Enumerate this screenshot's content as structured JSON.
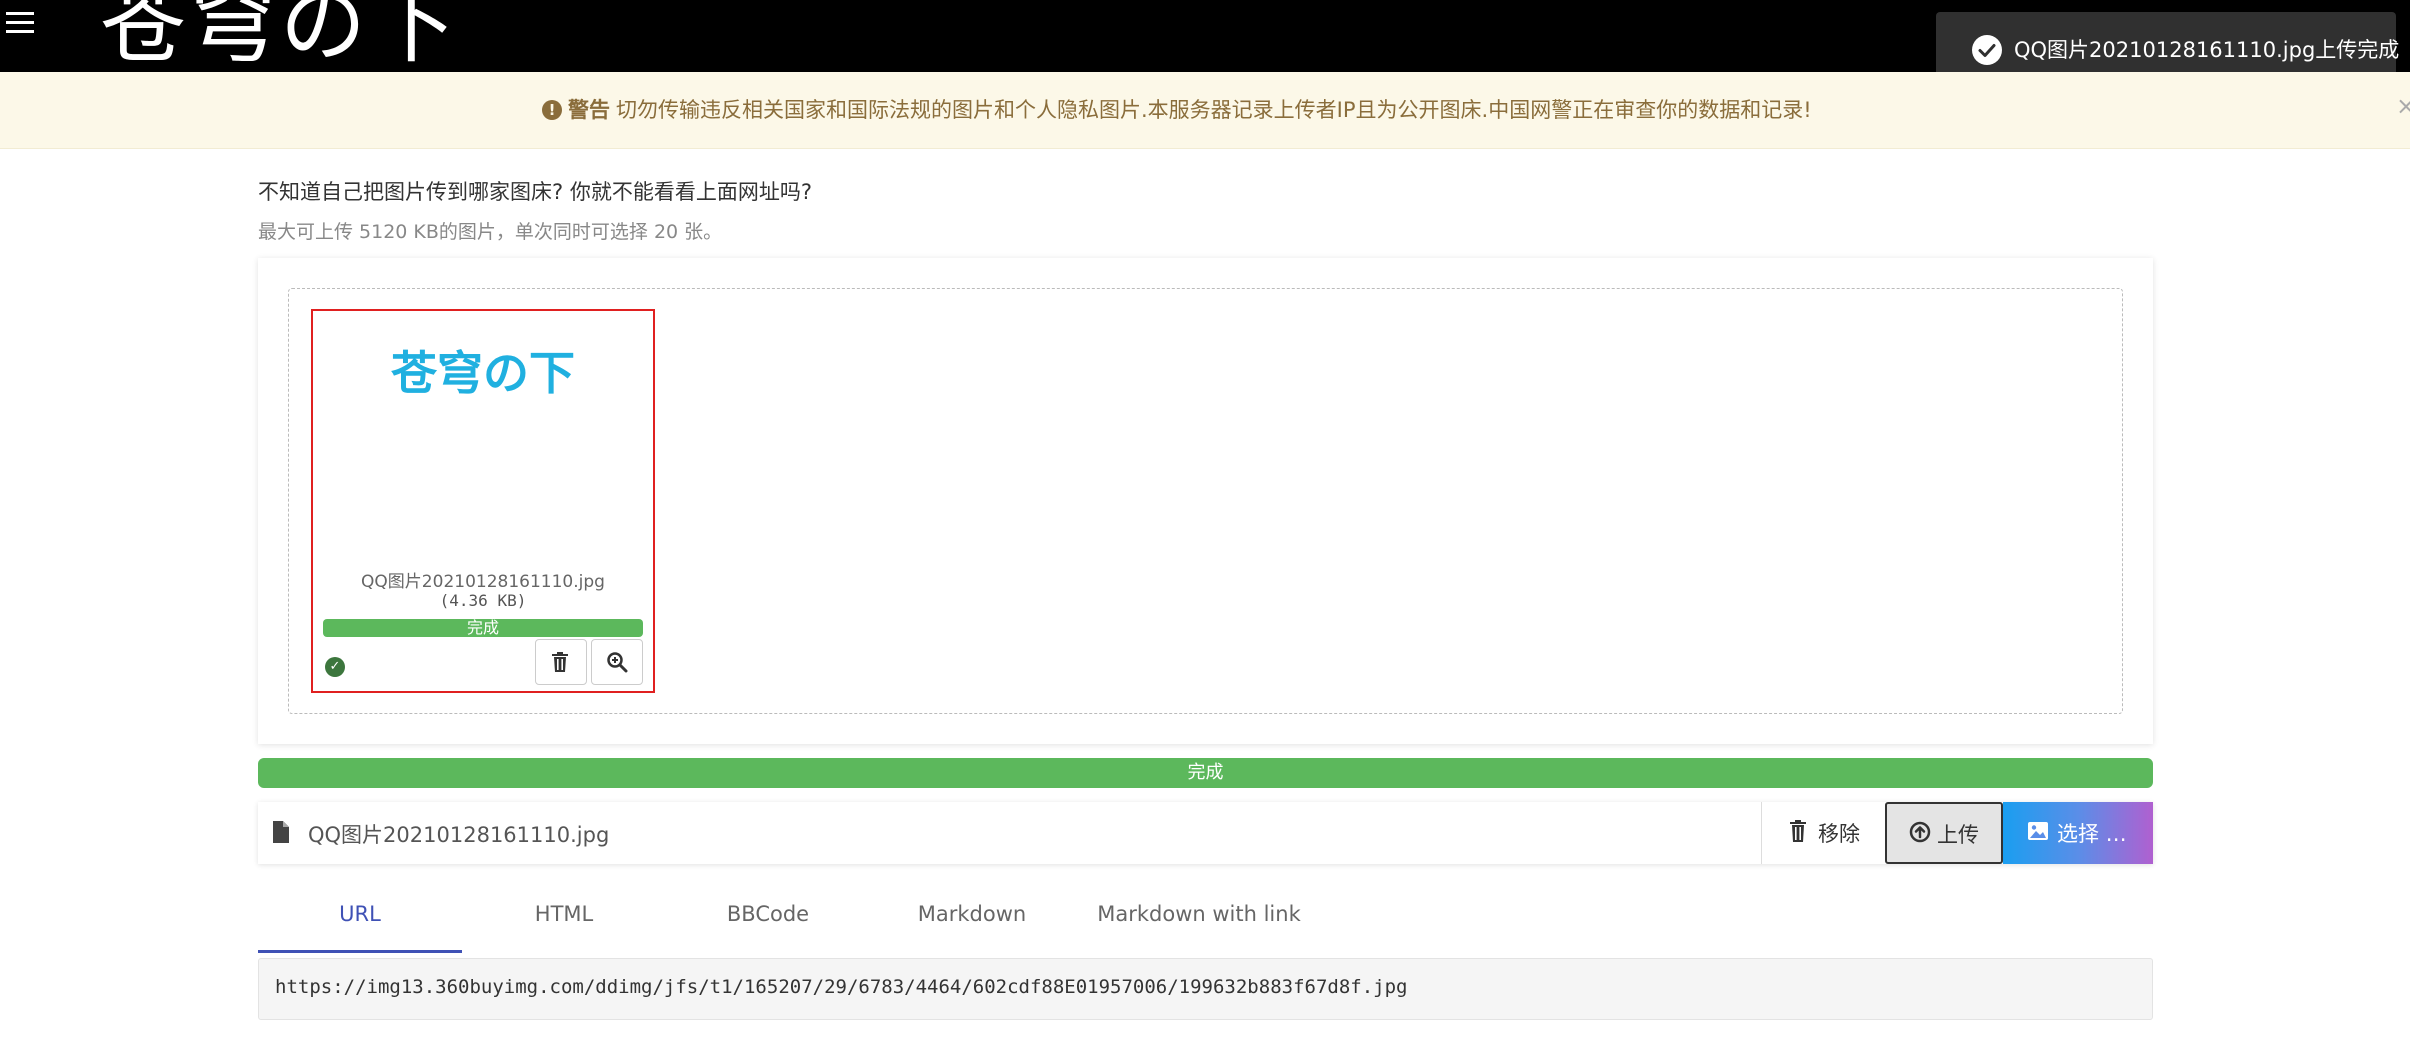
{
  "header": {
    "site_title": "苍穹の下",
    "menu_icon": "hamburger-menu-icon"
  },
  "toast": {
    "icon": "check-circle-icon",
    "message": "QQ图片20210128161110.jpg上传完成"
  },
  "warning": {
    "icon": "exclamation-circle-icon",
    "label": "警告",
    "text": "切勿传输违反相关国家和国际法规的图片和个人隐私图片.本服务器记录上传者IP且为公开图床.中国网警正在审查你的数据和记录!",
    "close": "×"
  },
  "intro": {
    "title": "不知道自己把图片传到哪家图床? 你就不能看看上面网址吗?",
    "subtitle": "最大可上传 5120 KB的图片，单次同时可选择 20 张。"
  },
  "thumbnail": {
    "image_text": "苍穹の下",
    "file_name": "QQ图片20210128161110.jpg",
    "file_size": "(4.36 KB)",
    "status": "完成",
    "progress_fraction": 1.0,
    "ok_icon": "check-circle-icon",
    "delete_icon": "trash-icon",
    "zoom_icon": "zoom-in-icon"
  },
  "main_progress": {
    "label": "完成",
    "progress_fraction": 1.0
  },
  "file_row": {
    "file_icon": "file-icon",
    "file_name": "QQ图片20210128161110.jpg",
    "remove_label": "移除",
    "upload_label": "上传",
    "choose_label": "选择 …"
  },
  "tabs": [
    "URL",
    "HTML",
    "BBCode",
    "Markdown",
    "Markdown with link"
  ],
  "active_tab": "URL",
  "result": {
    "link": "https://img13.360buyimg.com/ddimg/jfs/t1/165207/29/6783/4464/602cdf88E01957006/199632b883f67d8f.jpg"
  },
  "colors": {
    "accent": "#3f51b5",
    "success": "#5cb85c",
    "warning_text": "#8a6d3b",
    "warning_bg": "#fcf8e8",
    "highlight_border": "#e02020"
  }
}
